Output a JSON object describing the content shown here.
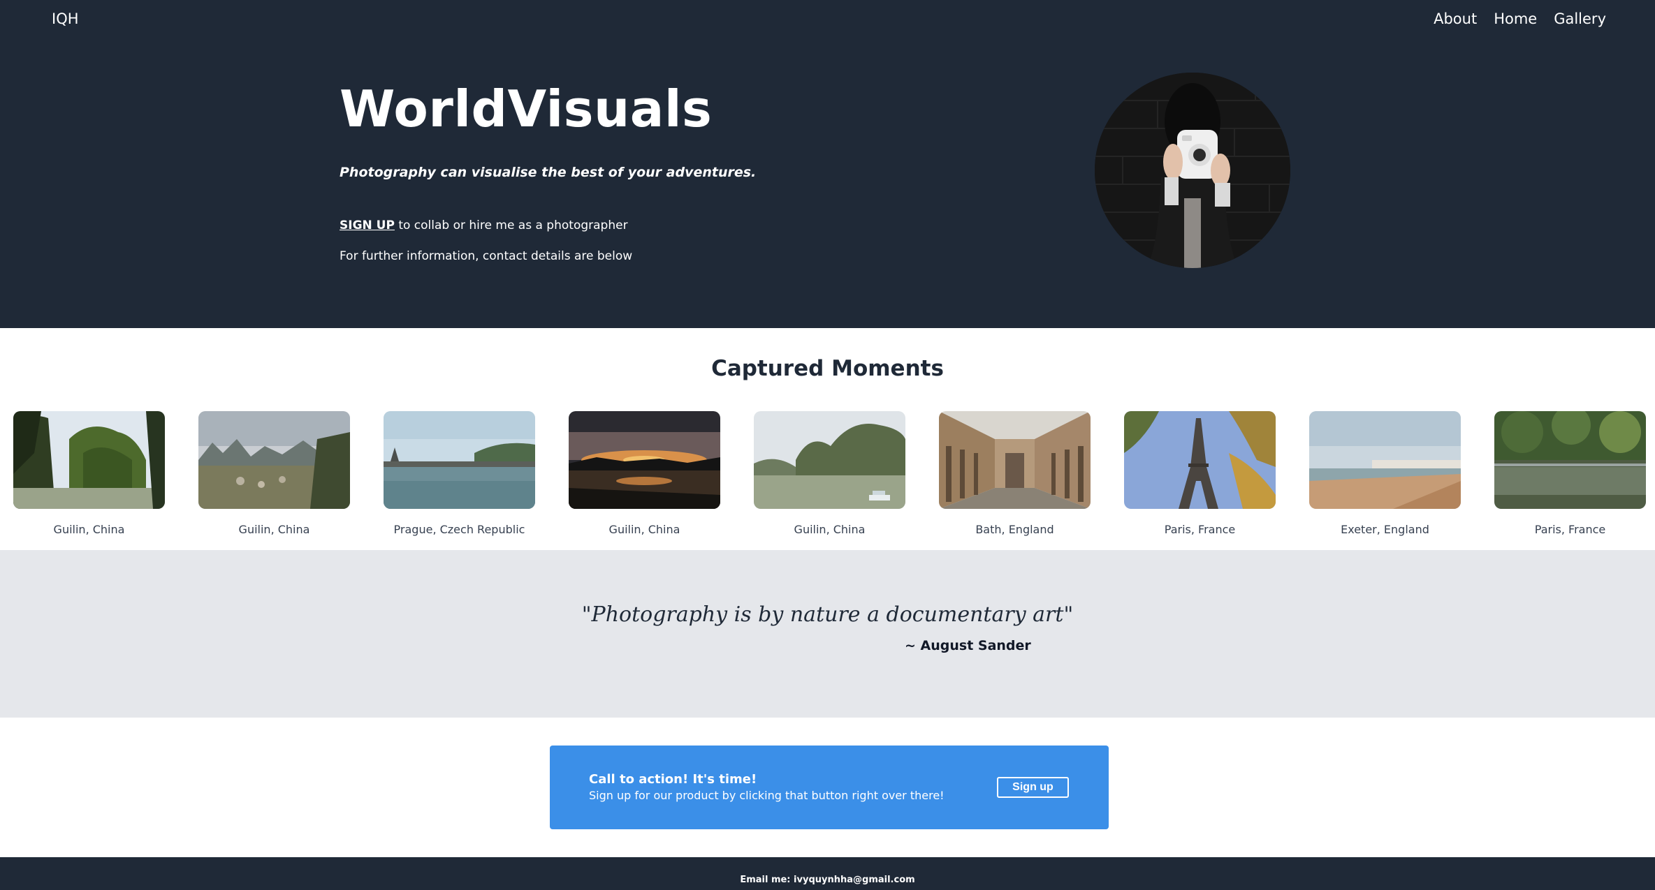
{
  "nav": {
    "logo": "IQH",
    "links": [
      "About",
      "Home",
      "Gallery"
    ]
  },
  "hero": {
    "title": "WorldVisuals",
    "tagline": "Photography can visualise the best of your adventures.",
    "signup_link": "SIGN UP",
    "signup_rest": " to collab or hire me as a photographer",
    "info": "For further information, contact details are below"
  },
  "moments": {
    "heading": "Captured Moments",
    "items": [
      {
        "caption": "Guilin, China",
        "scene": "karst-river"
      },
      {
        "caption": "Guilin, China",
        "scene": "karst-valley"
      },
      {
        "caption": "Prague, Czech Republic",
        "scene": "river-bridge"
      },
      {
        "caption": "Guilin, China",
        "scene": "sunset-river"
      },
      {
        "caption": "Guilin, China",
        "scene": "karst-boat"
      },
      {
        "caption": "Bath, England",
        "scene": "colonnade-street"
      },
      {
        "caption": "Paris, France",
        "scene": "eiffel-tower"
      },
      {
        "caption": "Exeter, England",
        "scene": "beach-town"
      },
      {
        "caption": "Paris, France",
        "scene": "canal-trees"
      }
    ]
  },
  "quote": {
    "text": "\"Photography is by nature a documentary art\"",
    "author": "~ August Sander"
  },
  "cta": {
    "title": "Call to action! It's time!",
    "subtitle": "Sign up for our product by clicking that button right over there!",
    "button": "Sign up"
  },
  "footer": {
    "email": "Email me: ivyquynhha@gmail.com"
  },
  "colors": {
    "dark": "#1f2937",
    "quote_bg": "#e5e7eb",
    "cta_bg": "#3b8fe8"
  }
}
